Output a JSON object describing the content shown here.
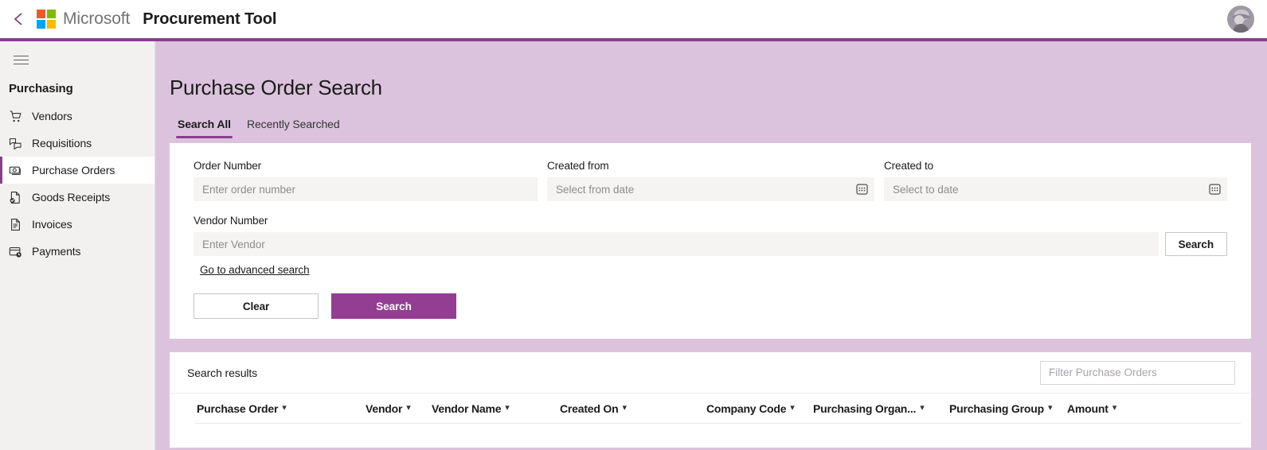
{
  "topbar": {
    "back_icon": "chevron-left-icon",
    "brand": "Microsoft",
    "app_title": "Procurement Tool",
    "logo_colors": [
      "#f05a22",
      "#7fba00",
      "#00a4ef",
      "#ffb900"
    ],
    "avatar_alt": "user-avatar"
  },
  "accent_color": "#8a3f8e",
  "content_bg": "#dcc3dd",
  "sidebar": {
    "menu_icon": "hamburger-icon",
    "header": "Purchasing",
    "items": [
      {
        "label": "Vendors",
        "icon": "shopping-cart-icon",
        "active": false
      },
      {
        "label": "Requisitions",
        "icon": "requisition-documents-icon",
        "active": false
      },
      {
        "label": "Purchase Orders",
        "icon": "money-stack-icon",
        "active": true
      },
      {
        "label": "Goods Receipts",
        "icon": "document-check-icon",
        "active": false
      },
      {
        "label": "Invoices",
        "icon": "invoice-document-icon",
        "active": false
      },
      {
        "label": "Payments",
        "icon": "wallet-clock-icon",
        "active": false
      }
    ]
  },
  "main": {
    "page_title": "Purchase Order Search",
    "tabs": [
      {
        "label": "Search All",
        "active": true
      },
      {
        "label": "Recently Searched",
        "active": false
      }
    ],
    "form": {
      "order_number": {
        "label": "Order Number",
        "placeholder": "Enter order number",
        "value": ""
      },
      "created_from": {
        "label": "Created from",
        "placeholder": "Select from date",
        "value": "",
        "icon": "calendar-icon"
      },
      "created_to": {
        "label": "Created to",
        "placeholder": "Select to date",
        "value": "",
        "icon": "calendar-icon"
      },
      "vendor_number": {
        "label": "Vendor Number",
        "placeholder": "Enter Vendor",
        "value": ""
      },
      "vendor_search_button": "Search",
      "advanced_search_link": "Go to advanced search",
      "clear_button": "Clear",
      "search_button": "Search"
    },
    "results": {
      "title": "Search results",
      "filter_placeholder": "Filter Purchase Orders",
      "filter_value": "",
      "columns": [
        "Purchase Order",
        "Vendor",
        "Vendor Name",
        "Created On",
        "Company Code",
        "Purchasing Organ...",
        "Purchasing Group",
        "Amount"
      ],
      "rows": []
    }
  }
}
